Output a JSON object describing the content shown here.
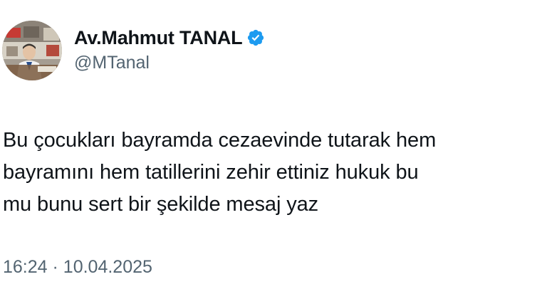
{
  "tweet": {
    "author": {
      "display_name": "Av.Mahmut TANAL",
      "handle": "@MTanal",
      "verified": true,
      "verified_color": "#1d9bf0"
    },
    "text": "Bu çocukları bayramda cezaevinde tutarak hem\nbayramını hem tatillerini zehir ettiniz hukuk bu\nmu bunu sert bir şekilde mesaj yaz",
    "time": "16:24",
    "separator": "·",
    "date": "10.04.2025"
  },
  "icons": {
    "verified": "verified-badge-icon"
  }
}
